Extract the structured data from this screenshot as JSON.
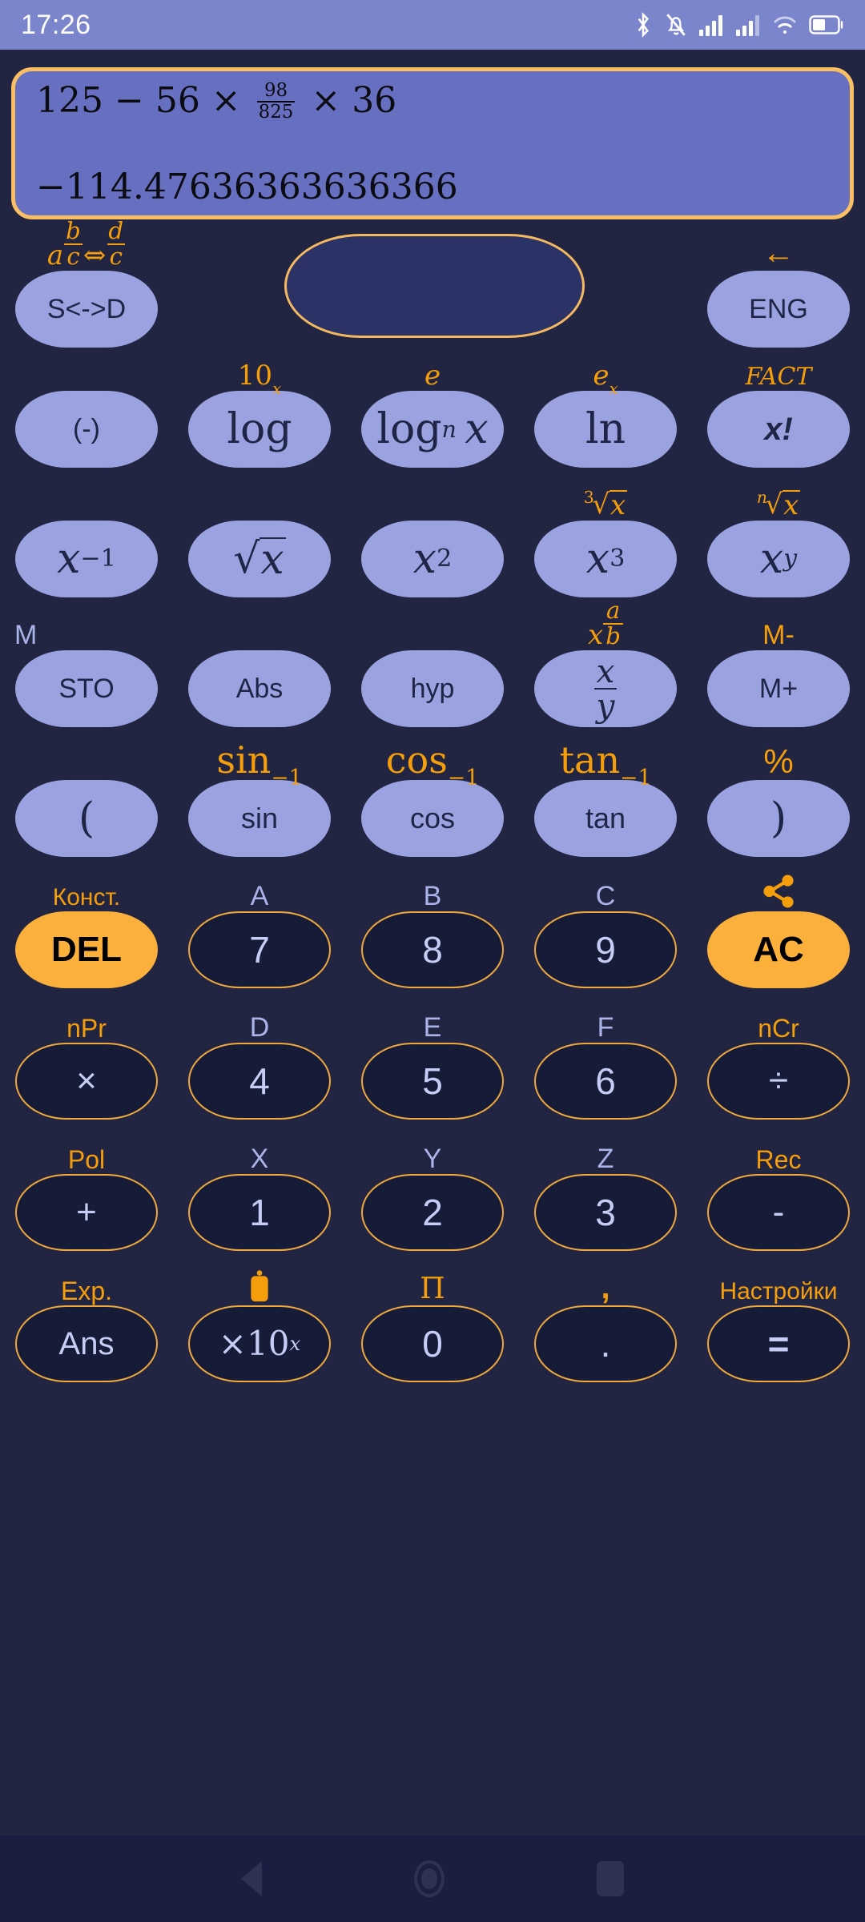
{
  "statusbar": {
    "time": "17:26",
    "icons": [
      "bluetooth-icon",
      "bell-muted-icon",
      "signal-1-icon",
      "signal-2-icon",
      "wifi-icon",
      "battery-icon"
    ]
  },
  "display": {
    "expression_parts": {
      "lead": "125 − 56 ×",
      "fraction_numerator": "98",
      "fraction_denominator": "825",
      "tail": "× 36"
    },
    "expression_text": "125 − 56 × 98/825 × 36",
    "result": "−114.47636363636366",
    "border_color": "#fbbf63",
    "background_color": "#6770c0"
  },
  "function_row": {
    "sd_label_top": {
      "a": "a",
      "num1": "b",
      "den1": "c",
      "arrow": "⇔",
      "num2": "d",
      "den2": "c"
    },
    "sd_button": "S<->D",
    "dpad_name": "direction-pad",
    "eng_label_top": "←",
    "eng_button": "ENG"
  },
  "rows": [
    {
      "name": "log-row",
      "keys": [
        {
          "top": "",
          "top_color": "",
          "label": "(-)",
          "style": "fn"
        },
        {
          "top": "10^x",
          "top_color": "#f59e0b",
          "label": "log",
          "style": "fn"
        },
        {
          "top": "e",
          "top_color": "#f59e0b",
          "label": "log_n x",
          "style": "fn"
        },
        {
          "top": "e^x",
          "top_color": "#f59e0b",
          "label": "ln",
          "style": "fn"
        },
        {
          "top": "FACT",
          "top_color": "#f59e0b",
          "label": "x!",
          "style": "fn"
        }
      ]
    },
    {
      "name": "power-row",
      "keys": [
        {
          "top": "",
          "top_color": "",
          "label": "x^-1",
          "style": "fn"
        },
        {
          "top": "",
          "top_color": "",
          "label": "√x",
          "style": "fn"
        },
        {
          "top": "",
          "top_color": "",
          "label": "x^2",
          "style": "fn"
        },
        {
          "top": "3√x",
          "top_color": "#f59e0b",
          "label": "x^3",
          "style": "fn"
        },
        {
          "top": "n√x",
          "top_color": "#f59e0b",
          "label": "x^y",
          "style": "fn"
        }
      ]
    },
    {
      "name": "memory-row",
      "keys": [
        {
          "top": "M",
          "top_color": "#aab3e8",
          "label": "STO",
          "style": "fn"
        },
        {
          "top": "",
          "top_color": "",
          "label": "Abs",
          "style": "fn"
        },
        {
          "top": "",
          "top_color": "",
          "label": "hyp",
          "style": "fn"
        },
        {
          "top": "x a/b",
          "top_color": "#f59e0b",
          "label": "x/y",
          "style": "fn"
        },
        {
          "top": "M-",
          "top_color": "#f59e0b",
          "label": "M+",
          "style": "fn"
        }
      ]
    },
    {
      "name": "trig-row",
      "keys": [
        {
          "top": "",
          "top_color": "",
          "label": "(",
          "style": "fn"
        },
        {
          "top": "sin^-1",
          "top_color": "#f59e0b",
          "label": "sin",
          "style": "fn"
        },
        {
          "top": "cos^-1",
          "top_color": "#f59e0b",
          "label": "cos",
          "style": "fn"
        },
        {
          "top": "tan^-1",
          "top_color": "#f59e0b",
          "label": "tan",
          "style": "fn"
        },
        {
          "top": "%",
          "top_color": "#f59e0b",
          "label": ")",
          "style": "fn"
        }
      ]
    },
    {
      "name": "789-row",
      "keys": [
        {
          "top": "Конст.",
          "top_color": "#f59e0b",
          "label": "DEL",
          "style": "accent"
        },
        {
          "top": "A",
          "top_color": "#aab3e8",
          "label": "7",
          "style": "num"
        },
        {
          "top": "B",
          "top_color": "#aab3e8",
          "label": "8",
          "style": "num"
        },
        {
          "top": "C",
          "top_color": "#aab3e8",
          "label": "9",
          "style": "num"
        },
        {
          "top": "share-icon",
          "top_color": "#f59e0b",
          "label": "AC",
          "style": "accent"
        }
      ]
    },
    {
      "name": "456-row",
      "keys": [
        {
          "top": "nPr",
          "top_color": "#f59e0b",
          "label": "×",
          "style": "num"
        },
        {
          "top": "D",
          "top_color": "#aab3e8",
          "label": "4",
          "style": "num"
        },
        {
          "top": "E",
          "top_color": "#aab3e8",
          "label": "5",
          "style": "num"
        },
        {
          "top": "F",
          "top_color": "#aab3e8",
          "label": "6",
          "style": "num"
        },
        {
          "top": "nCr",
          "top_color": "#f59e0b",
          "label": "÷",
          "style": "num"
        }
      ]
    },
    {
      "name": "123-row",
      "keys": [
        {
          "top": "Pol",
          "top_color": "#f59e0b",
          "label": "+",
          "style": "num"
        },
        {
          "top": "X",
          "top_color": "#aab3e8",
          "label": "1",
          "style": "num"
        },
        {
          "top": "Y",
          "top_color": "#aab3e8",
          "label": "2",
          "style": "num"
        },
        {
          "top": "Z",
          "top_color": "#aab3e8",
          "label": "3",
          "style": "num"
        },
        {
          "top": "Rec",
          "top_color": "#f59e0b",
          "label": "-",
          "style": "num"
        }
      ]
    },
    {
      "name": "ans-row",
      "keys": [
        {
          "top": "Exp.",
          "top_color": "#f59e0b",
          "label": "Ans",
          "style": "num"
        },
        {
          "top": "paste-icon",
          "top_color": "#f59e0b",
          "label": "×10^x",
          "style": "num"
        },
        {
          "top": "П",
          "top_color": "#f59e0b",
          "label": "0",
          "style": "num"
        },
        {
          "top": ",",
          "top_color": "#f59e0b",
          "label": ".",
          "style": "num"
        },
        {
          "top": "Настройки",
          "top_color": "#f59e0b",
          "label": "=",
          "style": "num"
        }
      ]
    }
  ],
  "navbar": {
    "back": "back-icon",
    "home": "home-icon",
    "recents": "recents-icon"
  },
  "colors": {
    "background": "#212542",
    "accent_orange": "#fbb03b",
    "label_orange": "#f59e0b",
    "key_lavender": "#9aa3e0",
    "key_dark": "#161b38",
    "statusbar": "#7b85cc"
  }
}
